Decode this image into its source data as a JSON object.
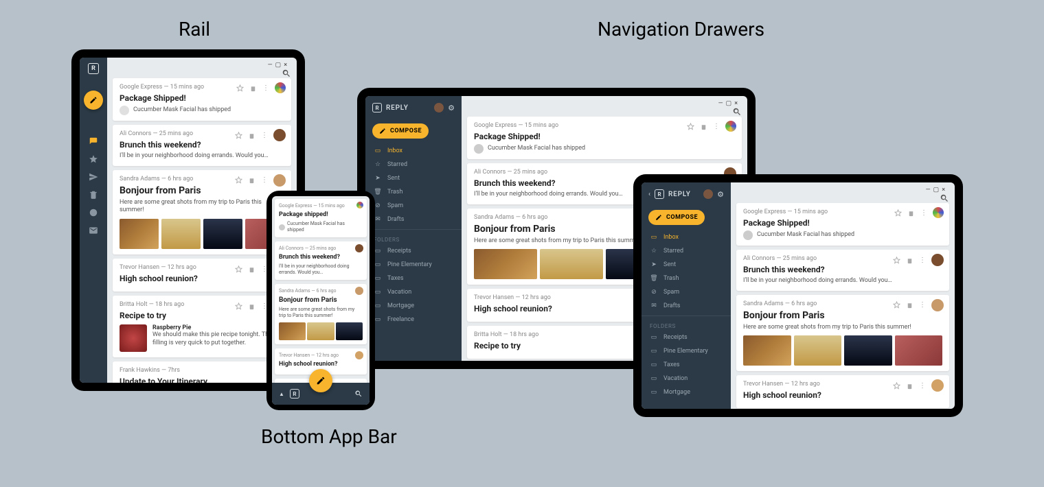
{
  "labels": {
    "rail": "Rail",
    "bottom_bar": "Bottom App Bar",
    "nav_drawers": "Navigation Drawers"
  },
  "brand": {
    "name": "REPLY",
    "logo_letter": "R"
  },
  "compose": {
    "label": "COMPOSE"
  },
  "nav_primary": [
    {
      "label": "Inbox",
      "icon": "inbox",
      "active": true
    },
    {
      "label": "Starred",
      "icon": "star"
    },
    {
      "label": "Sent",
      "icon": "send"
    },
    {
      "label": "Trash",
      "icon": "trash"
    },
    {
      "label": "Spam",
      "icon": "spam"
    },
    {
      "label": "Drafts",
      "icon": "drafts"
    }
  ],
  "nav_folders_heading": "FOLDERS",
  "nav_folders": [
    {
      "label": "Receipts"
    },
    {
      "label": "Pine Elementary"
    },
    {
      "label": "Taxes"
    },
    {
      "label": "Vacation"
    },
    {
      "label": "Mortgage"
    },
    {
      "label": "Freelance"
    }
  ],
  "emails": [
    {
      "meta": "Google Express — 15 mins ago",
      "title": "Package Shipped!",
      "snippet": "Cucumber Mask Facial has shipped",
      "avatar_color": "#d8d8d8"
    },
    {
      "meta": "Ali Connors — 25 mins ago",
      "title": "Brunch this weekend?",
      "snippet": "I'll be in your neighborhood doing errands. Would you…",
      "avatar_color": "#7a4d2e"
    },
    {
      "meta": "Sandra Adams — 6 hrs ago",
      "title": "Bonjour from Paris",
      "snippet": "Here are some great shots from my trip to Paris this summer!",
      "avatar_color": "#c89a6a",
      "images": true
    },
    {
      "meta": "Trevor Hansen — 12 hrs ago",
      "title": "High school reunion?",
      "snippet": "",
      "avatar_color": "#d1a165"
    },
    {
      "meta": "Britta Holt — 18 hrs ago",
      "title": "Recipe to try",
      "snippet": "We should make this pie recipe tonight. The filling is very quick to put together.",
      "recipe_name": "Raspberry Pie",
      "avatar_color": "#b08b57"
    },
    {
      "meta": "Frank Hawkins — 7hrs",
      "title": "Update to Your Itinerary",
      "snippet": "",
      "avatar_color": "#999"
    }
  ],
  "mobile_emails": {
    "shipped_title": "Package shipped!"
  }
}
